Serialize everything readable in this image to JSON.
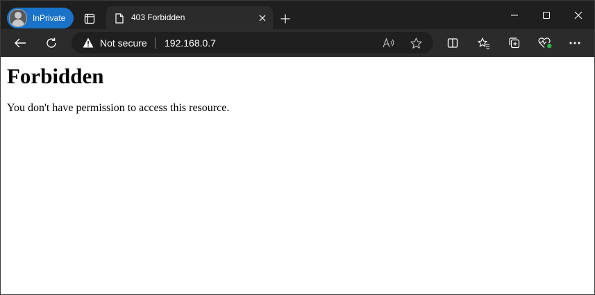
{
  "browser": {
    "inprivate_label": "InPrivate",
    "tab": {
      "title": "403 Forbidden"
    },
    "address": {
      "security_label": "Not secure",
      "url": "192.168.0.7"
    },
    "icons": {
      "avatar": "avatar",
      "tab_actions": "tab-actions-icon",
      "page": "page-icon",
      "close_tab": "close-icon",
      "new_tab": "plus-icon",
      "minimize": "minimize-icon",
      "maximize": "maximize-icon",
      "close_window": "close-icon",
      "back": "back-arrow-icon",
      "refresh": "refresh-icon",
      "warning": "warning-icon",
      "read_aloud": "read-aloud-icon",
      "favorite": "star-icon",
      "split_screen": "split-screen-icon",
      "favorites": "favorites-icon",
      "collections": "collections-icon",
      "browser_essentials": "heart-pulse-icon",
      "more": "more-icon"
    },
    "colors": {
      "titlebar": "#1f1f1f",
      "toolbar": "#2b2b2b",
      "inprivate_pill": "#1a73c8",
      "status_dot": "#2db34a"
    }
  },
  "page": {
    "heading": "Forbidden",
    "message": "You don't have permission to access this resource."
  }
}
